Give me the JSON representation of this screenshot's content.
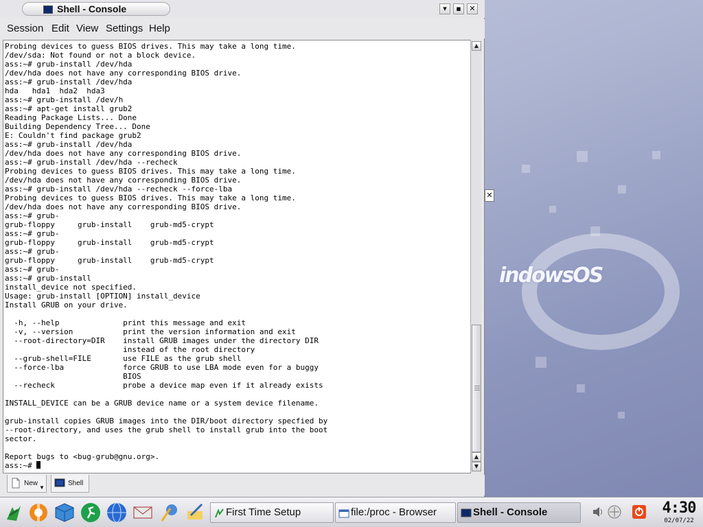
{
  "window": {
    "title": "Shell - Console",
    "controls": {
      "minimize": "▾",
      "maximize": "▪",
      "close": "✕"
    }
  },
  "menu": [
    "Session",
    "Edit",
    "View",
    "Settings",
    "Help"
  ],
  "terminal": {
    "lines": [
      "Probing devices to guess BIOS drives. This may take a long time.",
      "/dev/sda: Not found or not a block device.",
      "ass:~# grub-install /dev/hda",
      "/dev/hda does not have any corresponding BIOS drive.",
      "ass:~# grub-install /dev/hda",
      "hda   hda1  hda2  hda3",
      "ass:~# grub-install /dev/h",
      "ass:~# apt-get install grub2",
      "Reading Package Lists... Done",
      "Building Dependency Tree... Done",
      "E: Couldn't find package grub2",
      "ass:~# grub-install /dev/hda",
      "/dev/hda does not have any corresponding BIOS drive.",
      "ass:~# grub-install /dev/hda --recheck",
      "Probing devices to guess BIOS drives. This may take a long time.",
      "/dev/hda does not have any corresponding BIOS drive.",
      "ass:~# grub-install /dev/hda --recheck --force-lba",
      "Probing devices to guess BIOS drives. This may take a long time.",
      "/dev/hda does not have any corresponding BIOS drive.",
      "ass:~# grub-",
      "grub-floppy     grub-install    grub-md5-crypt",
      "ass:~# grub-",
      "grub-floppy     grub-install    grub-md5-crypt",
      "ass:~# grub-",
      "grub-floppy     grub-install    grub-md5-crypt",
      "ass:~# grub-",
      "ass:~# grub-install",
      "install_device not specified.",
      "Usage: grub-install [OPTION] install_device",
      "Install GRUB on your drive.",
      "",
      "  -h, --help              print this message and exit",
      "  -v, --version           print the version information and exit",
      "  --root-directory=DIR    install GRUB images under the directory DIR",
      "                          instead of the root directory",
      "  --grub-shell=FILE       use FILE as the grub shell",
      "  --force-lba             force GRUB to use LBA mode even for a buggy",
      "                          BIOS",
      "  --recheck               probe a device map even if it already exists",
      "",
      "INSTALL_DEVICE can be a GRUB device name or a system device filename.",
      "",
      "grub-install copies GRUB images into the DIR/boot directory specfied by",
      "--root-directory, and uses the grub shell to install grub into the boot",
      "sector.",
      "",
      "Report bugs to <bug-grub@gnu.org>.",
      "ass:~# "
    ]
  },
  "console_tabs": [
    {
      "label": "New",
      "icon": "new-session-icon"
    },
    {
      "label": "Shell",
      "icon": "terminal-icon"
    }
  ],
  "taskbar": {
    "launchers": [
      "kde-menu-icon",
      "lifebuoy-icon",
      "cube-icon",
      "runner-icon",
      "globe-icon",
      "mail-icon",
      "wizard-icon",
      "editor-icon"
    ],
    "tasks": [
      {
        "label": "First Time Setup",
        "icon": "setup-icon",
        "active": false
      },
      {
        "label": "file:/proc - Browser",
        "icon": "browser-icon",
        "active": false
      },
      {
        "label": "Shell - Console",
        "icon": "terminal-icon",
        "active": true
      }
    ],
    "tray": [
      "volume-icon",
      "network-icon",
      "power-icon"
    ],
    "clock": {
      "time": "4:30",
      "date": "02/07/22"
    }
  },
  "desktop": {
    "logo_text": "indowsOS"
  },
  "floating_close": "✕",
  "colors": {
    "accent": "#0c2a6a",
    "terminal_bg": "#ffffff",
    "terminal_fg": "#000000"
  }
}
